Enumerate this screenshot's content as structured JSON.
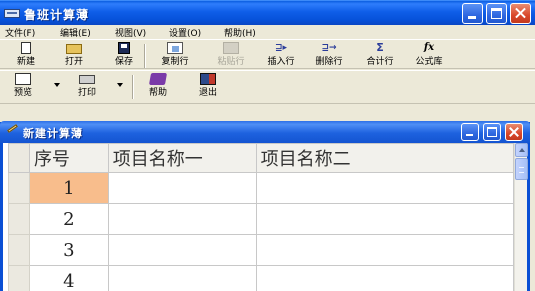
{
  "window": {
    "title": "鲁班计算薄"
  },
  "menubar": {
    "items": [
      {
        "label": "文件(F)"
      },
      {
        "label": "编辑(E)"
      },
      {
        "label": "视图(V)"
      },
      {
        "label": "设置(O)"
      },
      {
        "label": "帮助(H)"
      }
    ]
  },
  "toolbar1": {
    "new": "新建",
    "open": "打开",
    "save": "保存",
    "copy_row": "复制行",
    "paste_row": "粘贴行",
    "insert_row": "插入行",
    "delete_row": "删除行",
    "total_row": "合计行",
    "formula_lib": "公式库"
  },
  "toolbar2": {
    "preview": "预览",
    "print": "打印",
    "help": "帮助",
    "exit": "退出"
  },
  "child_window": {
    "title": "新建计算薄"
  },
  "grid": {
    "columns": [
      "序号",
      "项目名称一",
      "项目名称二"
    ],
    "rows": [
      {
        "no": "1",
        "selected": true
      },
      {
        "no": "2"
      },
      {
        "no": "3"
      },
      {
        "no": "4"
      }
    ]
  },
  "colors": {
    "titlebar_blue": "#0a5ee0",
    "selected_cell": "#f8bd8c",
    "close_red": "#d9472a"
  }
}
